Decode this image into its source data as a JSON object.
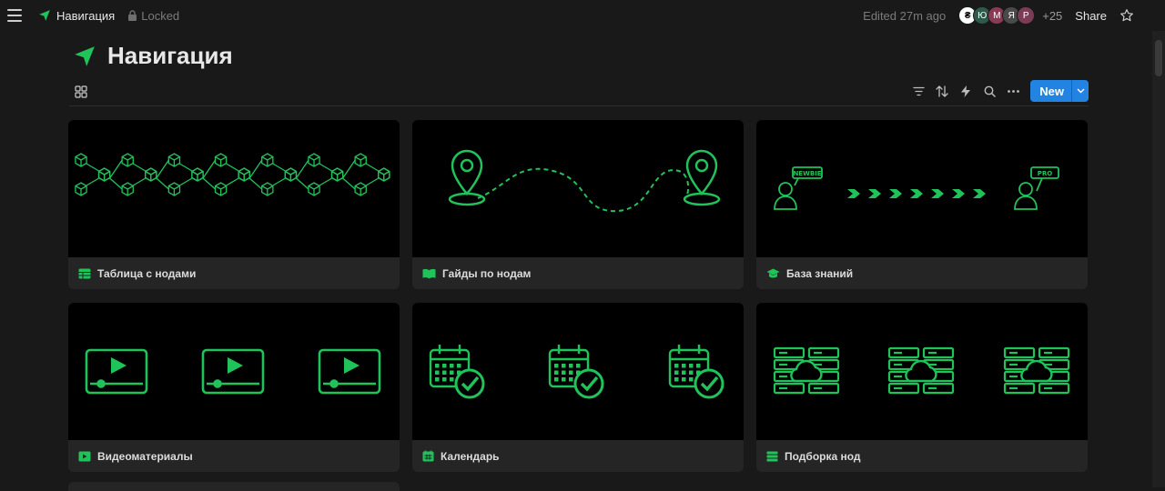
{
  "topbar": {
    "page_title": "Навигация",
    "lock_label": "Locked",
    "edited": "Edited 27m ago",
    "avatars": [
      {
        "letter": "",
        "color": "#ffffff"
      },
      {
        "letter": "Ю",
        "color": "#2d5a4a"
      },
      {
        "letter": "M",
        "color": "#8a3a55"
      },
      {
        "letter": "Я",
        "color": "#4a4a4a"
      },
      {
        "letter": "P",
        "color": "#7a3d55"
      }
    ],
    "more_count": "+25",
    "share_label": "Share"
  },
  "page": {
    "title": "Навигация"
  },
  "toolbar": {
    "new_label": "New"
  },
  "cards": [
    {
      "label": "Таблица с нодами",
      "icon": "table-icon",
      "cover": "hex-network"
    },
    {
      "label": "Гайды по нодам",
      "icon": "book-icon",
      "cover": "route-pins"
    },
    {
      "label": "База знаний",
      "icon": "graduation-cap-icon",
      "cover": "newbie-to-pro"
    },
    {
      "label": "Видеоматериалы",
      "icon": "video-icon",
      "cover": "video-players"
    },
    {
      "label": "Календарь",
      "icon": "calendar-icon",
      "cover": "calendar-checks"
    },
    {
      "label": "Подборка нод",
      "icon": "list-icon",
      "cover": "cloud-servers"
    }
  ],
  "colors": {
    "accent": "#1fc35a",
    "blue": "#2383e2",
    "background": "#191919",
    "card": "#252525"
  },
  "cover_text": {
    "newbie": "NEWBIE",
    "pro": "PRO"
  }
}
